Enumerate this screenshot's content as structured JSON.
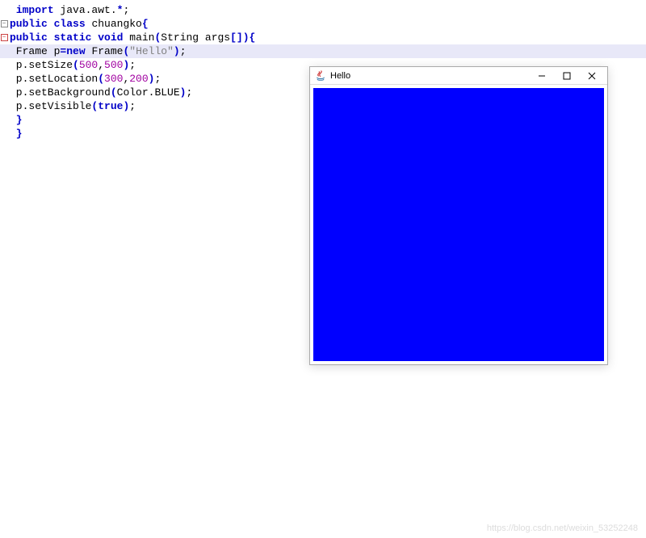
{
  "code": {
    "lines": [
      {
        "fold": null,
        "tokens": [
          {
            "cls": "txt",
            "text": " "
          },
          {
            "cls": "kw",
            "text": "import"
          },
          {
            "cls": "txt",
            "text": " java.awt."
          },
          {
            "cls": "punct",
            "text": "*"
          },
          {
            "cls": "plain-punct",
            "text": ";"
          }
        ]
      },
      {
        "fold": "minus",
        "tokens": [
          {
            "cls": "kw",
            "text": "public"
          },
          {
            "cls": "txt",
            "text": " "
          },
          {
            "cls": "kw",
            "text": "class"
          },
          {
            "cls": "txt",
            "text": " chuangko"
          },
          {
            "cls": "punct",
            "text": "{"
          }
        ]
      },
      {
        "fold": "minus-red",
        "tokens": [
          {
            "cls": "kw",
            "text": "public"
          },
          {
            "cls": "txt",
            "text": " "
          },
          {
            "cls": "kw",
            "text": "static"
          },
          {
            "cls": "txt",
            "text": " "
          },
          {
            "cls": "kw",
            "text": "void"
          },
          {
            "cls": "txt",
            "text": " main"
          },
          {
            "cls": "punct",
            "text": "("
          },
          {
            "cls": "txt",
            "text": "String args"
          },
          {
            "cls": "punct",
            "text": "[])"
          },
          {
            "cls": "punct",
            "text": "{"
          }
        ]
      },
      {
        "fold": null,
        "highlight": true,
        "tokens": [
          {
            "cls": "txt",
            "text": " Frame p"
          },
          {
            "cls": "punct",
            "text": "="
          },
          {
            "cls": "kw",
            "text": "new"
          },
          {
            "cls": "txt",
            "text": " Frame"
          },
          {
            "cls": "punct",
            "text": "("
          },
          {
            "cls": "str",
            "text": "\"Hello\""
          },
          {
            "cls": "punct",
            "text": ")"
          },
          {
            "cls": "plain-punct",
            "text": ";"
          }
        ]
      },
      {
        "fold": null,
        "tokens": [
          {
            "cls": "txt",
            "text": " p.setSize"
          },
          {
            "cls": "punct",
            "text": "("
          },
          {
            "cls": "num",
            "text": "500"
          },
          {
            "cls": "plain-punct",
            "text": ","
          },
          {
            "cls": "num",
            "text": "500"
          },
          {
            "cls": "punct",
            "text": ")"
          },
          {
            "cls": "plain-punct",
            "text": ";"
          }
        ]
      },
      {
        "fold": null,
        "tokens": [
          {
            "cls": "txt",
            "text": " p.setLocation"
          },
          {
            "cls": "punct",
            "text": "("
          },
          {
            "cls": "num",
            "text": "300"
          },
          {
            "cls": "plain-punct",
            "text": ","
          },
          {
            "cls": "num",
            "text": "200"
          },
          {
            "cls": "punct",
            "text": ")"
          },
          {
            "cls": "plain-punct",
            "text": ";"
          }
        ]
      },
      {
        "fold": null,
        "tokens": [
          {
            "cls": "txt",
            "text": " p.setBackground"
          },
          {
            "cls": "punct",
            "text": "("
          },
          {
            "cls": "txt",
            "text": "Color.BLUE"
          },
          {
            "cls": "punct",
            "text": ")"
          },
          {
            "cls": "plain-punct",
            "text": ";"
          }
        ]
      },
      {
        "fold": null,
        "tokens": [
          {
            "cls": "txt",
            "text": " p.setVisible"
          },
          {
            "cls": "punct",
            "text": "("
          },
          {
            "cls": "kw",
            "text": "true"
          },
          {
            "cls": "punct",
            "text": ")"
          },
          {
            "cls": "plain-punct",
            "text": ";"
          }
        ]
      },
      {
        "fold": "end",
        "tokens": [
          {
            "cls": "punct",
            "text": " }"
          }
        ]
      },
      {
        "fold": "end",
        "tokens": [
          {
            "cls": "punct",
            "text": " }"
          }
        ]
      }
    ]
  },
  "window": {
    "title": "Hello",
    "body_color": "#0000ff"
  },
  "watermark": "https://blog.csdn.net/weixin_53252248"
}
